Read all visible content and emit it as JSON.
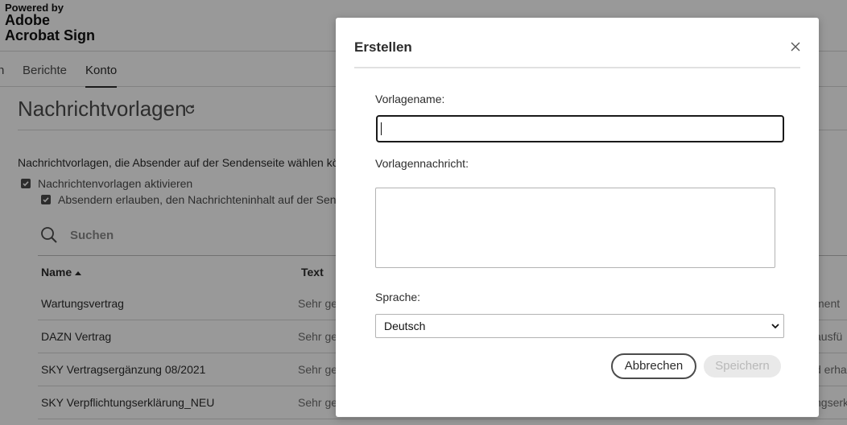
{
  "brand": {
    "powered_by": "Powered by",
    "line1": "Adobe",
    "line2": "Acrobat Sign"
  },
  "nav": {
    "partial_left": "n",
    "items": [
      {
        "label": "Berichte",
        "active": false
      },
      {
        "label": "Konto",
        "active": true
      }
    ]
  },
  "page": {
    "title": "Nachrichtvorlagen",
    "description": "Nachrichtvorlagen, die Absender auf der Sendenseite wählen kön",
    "checkbox1_label": "Nachrichtenvorlagen aktivieren",
    "checkbox2_label": "Absendern erlauben, den Nachrichteninhalt auf der Senden",
    "search_placeholder": "Suchen"
  },
  "table": {
    "columns": [
      "Name",
      "Text"
    ],
    "rows": [
      {
        "name": "Wartungsvertrag",
        "text": "Sehr gee",
        "tail": "ment"
      },
      {
        "name": "DAZN Vertrag",
        "text": "Sehr gee",
        "tail": "ausfü"
      },
      {
        "name": "SKY Vertragsergänzung 08/2021",
        "text": "Sehr gee",
        "tail": "d erha"
      },
      {
        "name": "SKY Verpflichtungserklärung_NEU",
        "text": "Sehr gee",
        "tail": "ngserk"
      }
    ]
  },
  "modal": {
    "title": "Erstellen",
    "name_label": "Vorlagename:",
    "name_value": "",
    "message_label": "Vorlagennachricht:",
    "message_value": "",
    "language_label": "Sprache:",
    "language_value": "Deutsch",
    "cancel_label": "Abbrechen",
    "save_label": "Speichern"
  },
  "icons": {
    "refresh": "refresh-icon",
    "search": "search-icon",
    "close": "close-icon",
    "chevron": "chevron-down-icon",
    "checkbox": "checkmark-icon",
    "sort": "sort-ascending-icon"
  },
  "colors": {
    "overlay": "#000000",
    "text": "#2c2c2c",
    "input_focus_border": "#1a1a1a",
    "disabled_button_bg": "#e9e9e9"
  }
}
